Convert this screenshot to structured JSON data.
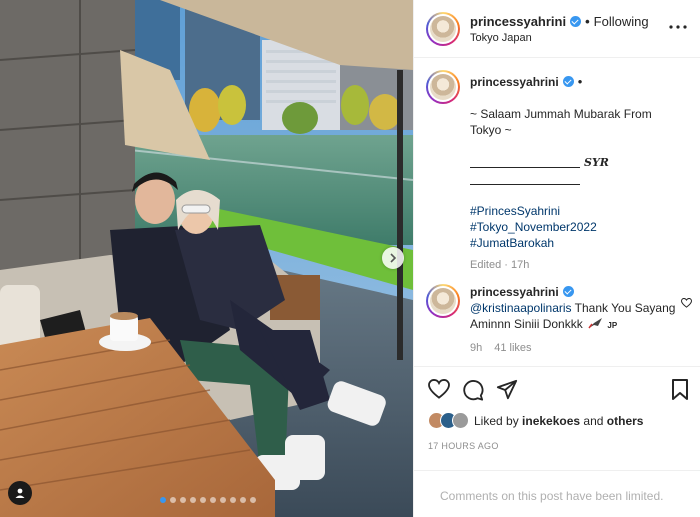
{
  "post": {
    "username": "princessyahrini",
    "follow_label": "Following",
    "separator": "•",
    "location": "Tokyo Japan",
    "more_icon": "more-horizontal-icon"
  },
  "caption": {
    "username": "princessyahrini",
    "line1": "~ Salaam Jummah Mubarak From",
    "line2": "Tokyo ~",
    "signature": "SYR",
    "hashtags": [
      "#PrincesSyahrini",
      "#Tokyo_November2022",
      "#JumatBarokah"
    ],
    "edited": "Edited",
    "age": "17h"
  },
  "comment": {
    "username": "princessyahrini",
    "mention": "@kristinaapolinaris",
    "text": " Thank You Sayang Aminnn Siniii Donkkk",
    "emoji_label": "JP",
    "age": "9h",
    "likes": "41 likes"
  },
  "likes_bar": {
    "prefix": "Liked by ",
    "user": "inekekoes",
    "suffix": " and ",
    "others": "others"
  },
  "timestamp": "17 HOURS AGO",
  "comments_limited": "Comments on this post have been limited.",
  "carousel": {
    "total": 10,
    "active": 1
  },
  "colors": {
    "accent": "#3897f0",
    "verified": "#3897f0",
    "link": "#00376b"
  }
}
